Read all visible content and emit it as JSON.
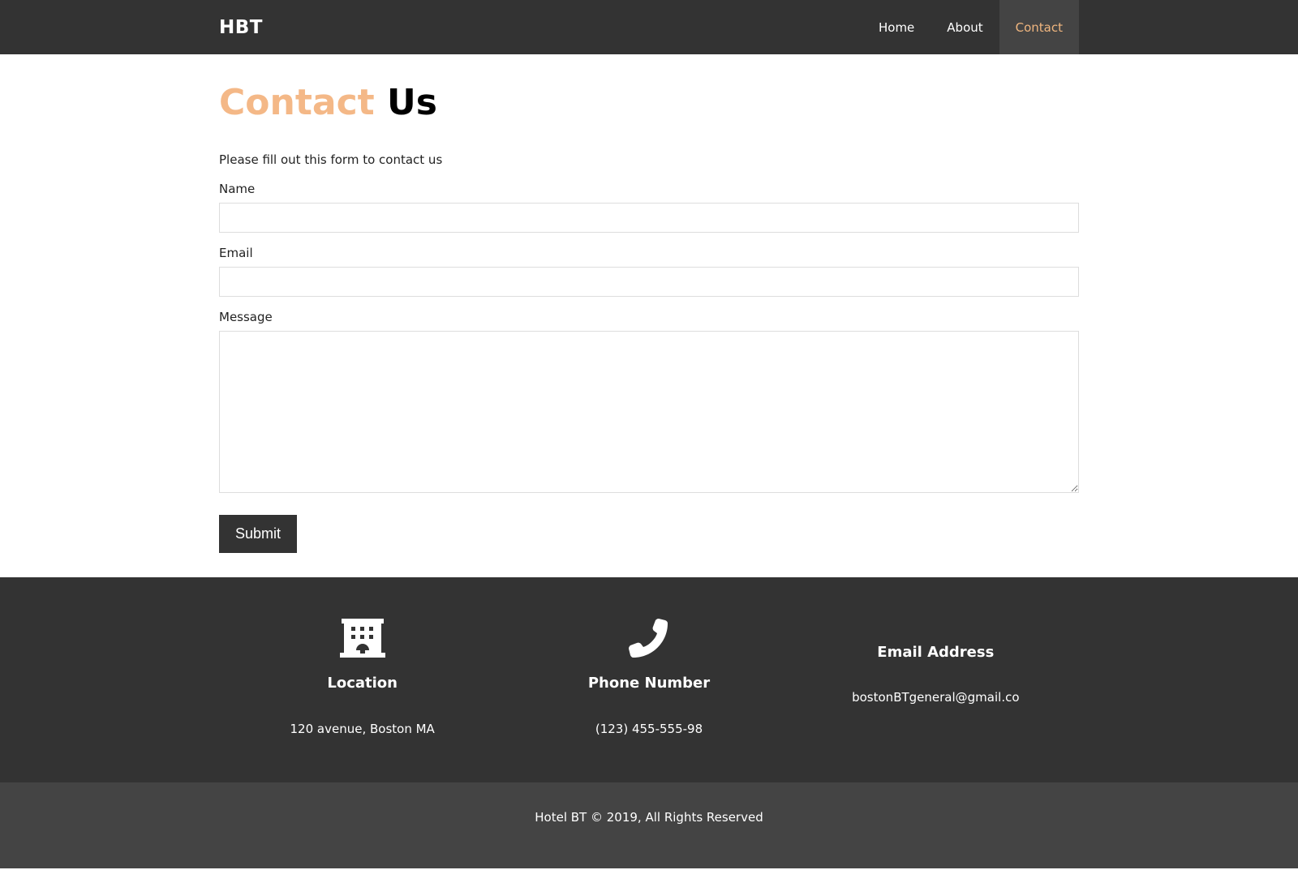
{
  "nav": {
    "brand": "HBT",
    "links": [
      {
        "label": "Home"
      },
      {
        "label": "About"
      },
      {
        "label": "Contact"
      }
    ],
    "active_color": "#f0b67f"
  },
  "main": {
    "title_accent": "Contact",
    "title_rest": "Us",
    "intro": "Please fill out this form to contact us",
    "fields": {
      "name_label": "Name",
      "name_value": "",
      "email_label": "Email",
      "email_value": "",
      "message_label": "Message",
      "message_value": ""
    },
    "submit_label": "Submit"
  },
  "footer": {
    "location": {
      "icon": "building-icon",
      "title": "Location",
      "text": "120 avenue, Boston MA"
    },
    "phone": {
      "icon": "phone-icon",
      "title": "Phone Number",
      "text": "(123) 455-555-98"
    },
    "email": {
      "title": "Email Address",
      "text": "bostonBTgeneral@gmail.co"
    },
    "copyright": "Hotel BT © 2019, All Rights Reserved"
  },
  "colors": {
    "dark": "#333333",
    "darker_bar": "#444444",
    "accent": "#f4b887"
  }
}
